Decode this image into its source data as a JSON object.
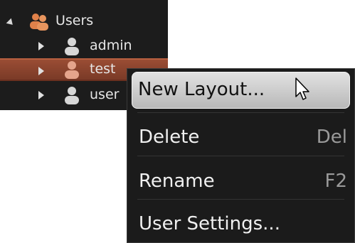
{
  "tree": {
    "root": {
      "label": "Users",
      "icon": "users-group-icon",
      "expanded": true
    },
    "children": [
      {
        "label": "admin",
        "icon": "user-icon",
        "selected": false
      },
      {
        "label": "test",
        "icon": "user-icon",
        "selected": true
      },
      {
        "label": "user",
        "icon": "user-icon",
        "selected": false
      }
    ]
  },
  "context_menu": {
    "items": [
      {
        "label": "New Layout...",
        "shortcut": "",
        "highlighted": true
      },
      {
        "label": "Delete",
        "shortcut": "Del",
        "highlighted": false
      },
      {
        "label": "Rename",
        "shortcut": "F2",
        "highlighted": false
      },
      {
        "label": "User Settings...",
        "shortcut": "",
        "highlighted": false
      }
    ]
  },
  "colors": {
    "tree_bg": "#1c1c1c",
    "selection": "#8a4430",
    "group_icon": "#e0814a",
    "user_icon": "#d7d7d7",
    "menu_bg": "#1b1b1b",
    "menu_highlight": "#cfcfcf"
  }
}
